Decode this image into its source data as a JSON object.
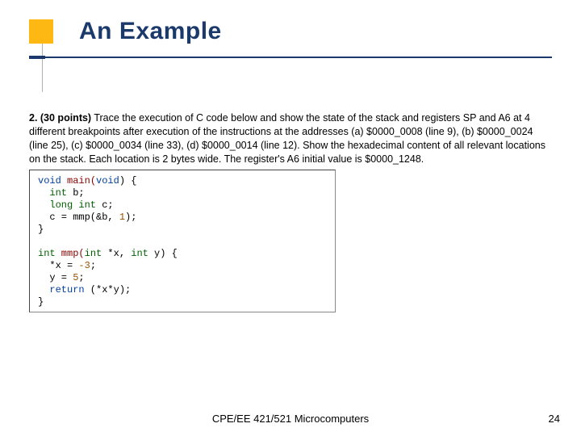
{
  "title": "An Example",
  "question": {
    "number": "2. (30 points)",
    "body": "Trace the execution of C code below and show the state of the stack and registers SP and A6 at 4 different breakpoints after execution of the instructions at the addresses (a) $0000_0008 (line 9), (b) $0000_0024 (line 25), (c) $0000_0034 (line 33), (d) $0000_0014 (line 12). Show the hexadecimal content of all relevant locations on the stack.  Each location is 2 bytes wide.  The register's A6 initial value is $0000_1248."
  },
  "code": {
    "l1a": "void",
    "l1b": " main(",
    "l1c": "void",
    "l1d": ") {",
    "l2a": "  int",
    "l2b": " b;",
    "l3a": "  long int",
    "l3b": " c;",
    "l4a": "  c = mmp(&b, ",
    "l4b": "1",
    "l4c": ");",
    "l5": "}",
    "blank": " ",
    "l6a": "int",
    "l6b": " mmp(",
    "l6c": "int",
    "l6d": " *x, ",
    "l6e": "int",
    "l6f": " y) {",
    "l7a": "  *x = ",
    "l7b": "-3",
    "l7c": ";",
    "l8a": "  y = ",
    "l8b": "5",
    "l8c": ";",
    "l9a": "  return",
    "l9b": " (*x*y);",
    "l10": "}"
  },
  "footer": {
    "course": "CPE/EE 421/521 Microcomputers",
    "page": "24"
  }
}
